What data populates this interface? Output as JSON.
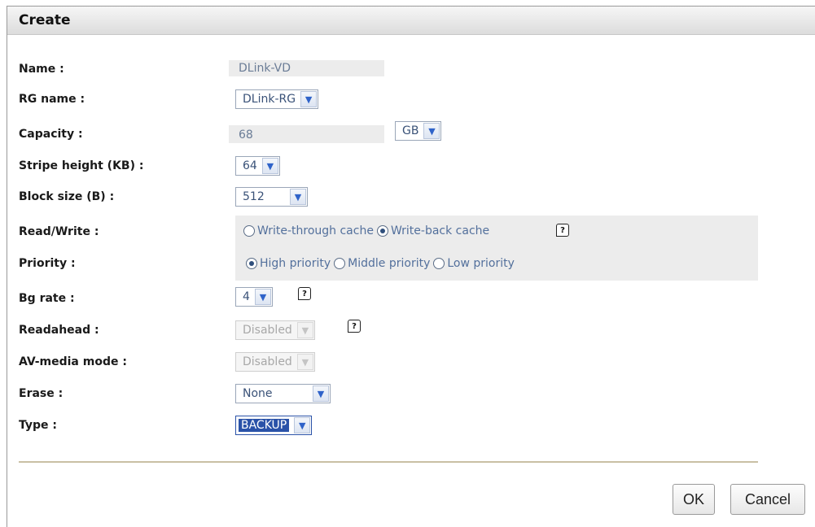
{
  "dialog": {
    "title": "Create"
  },
  "fields": {
    "name": {
      "label": "Name :",
      "value": "DLink-VD"
    },
    "rg_name": {
      "label": "RG name :",
      "value": "DLink-RG"
    },
    "capacity": {
      "label": "Capacity :",
      "value": "68",
      "unit": "GB"
    },
    "stripe_height": {
      "label": "Stripe height (KB) :",
      "value": "64"
    },
    "block_size": {
      "label": "Block size (B) :",
      "value": "512"
    },
    "read_write": {
      "label": "Read/Write :",
      "options": [
        {
          "label": "Write-through cache",
          "selected": false
        },
        {
          "label": "Write-back cache",
          "selected": true
        }
      ]
    },
    "priority": {
      "label": "Priority :",
      "options": [
        {
          "label": "High priority",
          "selected": true
        },
        {
          "label": "Middle priority",
          "selected": false
        },
        {
          "label": "Low priority",
          "selected": false
        }
      ]
    },
    "bg_rate": {
      "label": "Bg rate :",
      "value": "4"
    },
    "readahead": {
      "label": "Readahead :",
      "value": "Disabled"
    },
    "av_media_mode": {
      "label": "AV-media mode :",
      "value": "Disabled"
    },
    "erase": {
      "label": "Erase :",
      "value": "None"
    },
    "type": {
      "label": "Type :",
      "value": "BACKUP"
    }
  },
  "help_icon": "help-icon",
  "buttons": {
    "ok": "OK",
    "cancel": "Cancel"
  },
  "colors": {
    "accent": "#2a52a8",
    "shaded_bg": "#ececec",
    "divider": "#c9c0a4"
  }
}
